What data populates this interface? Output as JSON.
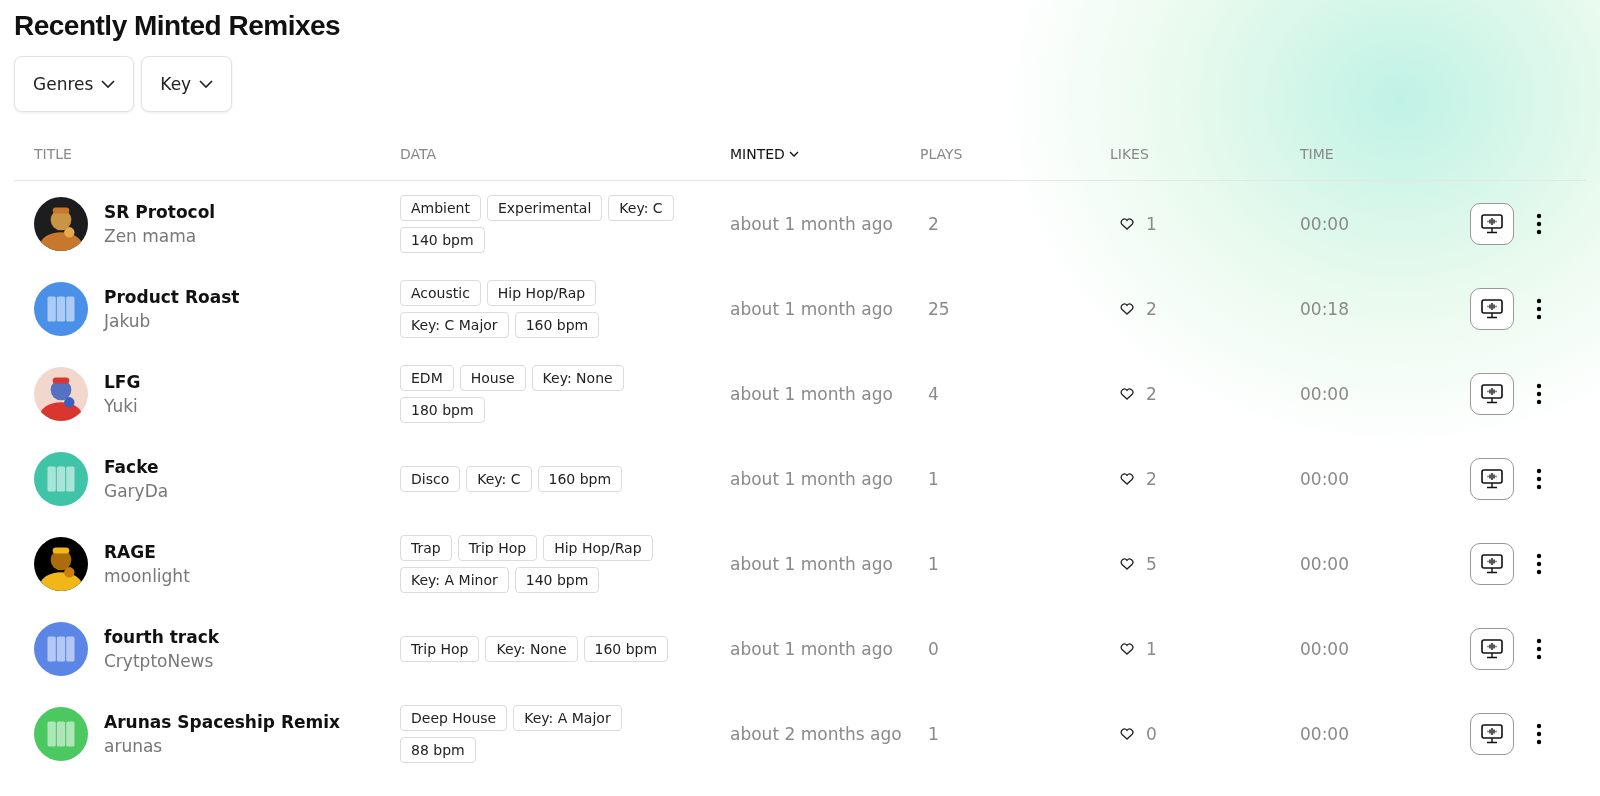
{
  "title": "Recently Minted Remixes",
  "filters": [
    {
      "label": "Genres"
    },
    {
      "label": "Key"
    }
  ],
  "table": {
    "columns": [
      {
        "label": "TITLE",
        "sorted": false
      },
      {
        "label": "DATA",
        "sorted": false
      },
      {
        "label": "MINTED",
        "sorted": true
      },
      {
        "label": "PLAYS",
        "sorted": false
      },
      {
        "label": "LIKES",
        "sorted": false
      },
      {
        "label": "TIME",
        "sorted": false
      }
    ],
    "rows": [
      {
        "title": "SR Protocol",
        "artist": "Zen mama",
        "avatar": {
          "kind": "picture"
        },
        "tags": [
          "Ambient",
          "Experimental",
          "Key: C",
          "140 bpm"
        ],
        "minted": "about 1 month ago",
        "plays": "2",
        "likes": "1",
        "time": "00:00"
      },
      {
        "title": "Product Roast",
        "artist": "Jakub",
        "avatar": {
          "kind": "piano",
          "color": "#4a8fe8"
        },
        "tags": [
          "Acoustic",
          "Hip Hop/Rap",
          "Key: C Major",
          "160 bpm"
        ],
        "minted": "about 1 month ago",
        "plays": "25",
        "likes": "2",
        "time": "00:18"
      },
      {
        "title": "LFG",
        "artist": "Yuki",
        "avatar": {
          "kind": "picture"
        },
        "tags": [
          "EDM",
          "House",
          "Key: None",
          "180 bpm"
        ],
        "minted": "about 1 month ago",
        "plays": "4",
        "likes": "2",
        "time": "00:00"
      },
      {
        "title": "Facke",
        "artist": "GaryDa",
        "avatar": {
          "kind": "piano",
          "color": "#3fc4a8"
        },
        "tags": [
          "Disco",
          "Key: C",
          "160 bpm"
        ],
        "minted": "about 1 month ago",
        "plays": "1",
        "likes": "2",
        "time": "00:00"
      },
      {
        "title": "RAGE",
        "artist": "moonlight",
        "avatar": {
          "kind": "picture"
        },
        "tags": [
          "Trap",
          "Trip Hop",
          "Hip Hop/Rap",
          "Key: A Minor",
          "140 bpm"
        ],
        "minted": "about 1 month ago",
        "plays": "1",
        "likes": "5",
        "time": "00:00"
      },
      {
        "title": "fourth track",
        "artist": "CrytptoNews",
        "avatar": {
          "kind": "piano",
          "color": "#5b86e6"
        },
        "tags": [
          "Trip Hop",
          "Key: None",
          "160 bpm"
        ],
        "minted": "about 1 month ago",
        "plays": "0",
        "likes": "1",
        "time": "00:00"
      },
      {
        "title": "Arunas Spaceship Remix",
        "artist": "arunas",
        "avatar": {
          "kind": "piano",
          "color": "#4cc860"
        },
        "tags": [
          "Deep House",
          "Key: A Major",
          "88 bpm"
        ],
        "minted": "about 2 months ago",
        "plays": "1",
        "likes": "0",
        "time": "00:00"
      }
    ]
  }
}
